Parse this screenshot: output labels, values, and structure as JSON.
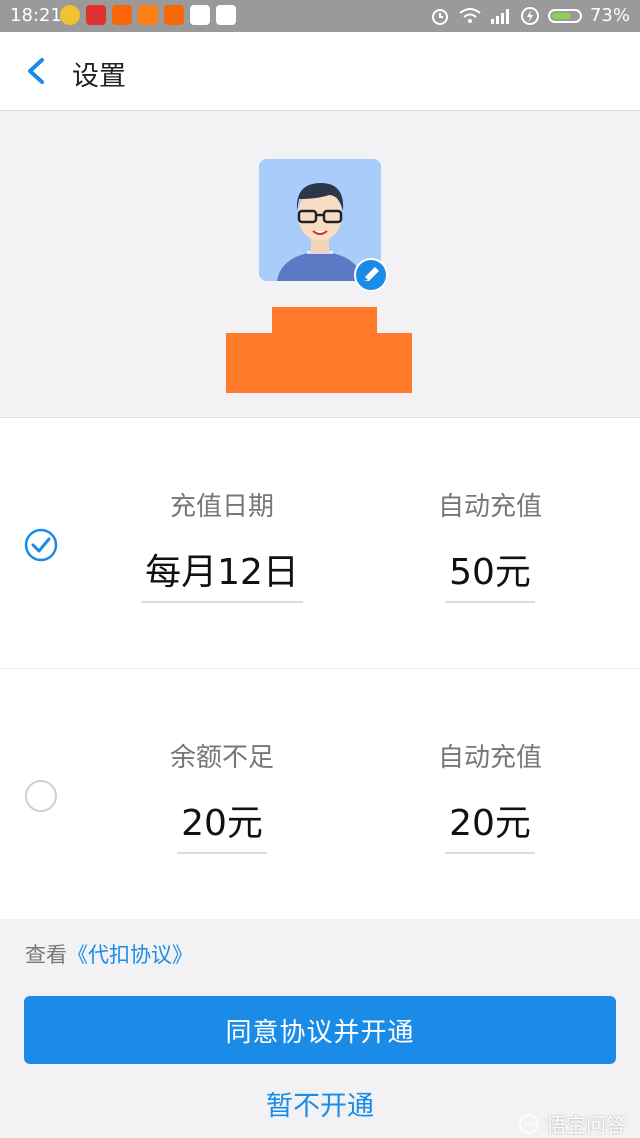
{
  "status_bar": {
    "time": "18:21",
    "battery": "73%",
    "battery_level": 0.73,
    "icons": [
      "app-icon",
      "app-icon",
      "app-icon",
      "app-icon",
      "app-icon",
      "app-icon",
      "app-icon",
      "alarm-icon",
      "wifi-icon",
      "signal-icon",
      "charging-icon",
      "battery-icon"
    ]
  },
  "header": {
    "title": "设置",
    "back_icon": "chevron-left-icon"
  },
  "profile": {
    "avatar": "avatar-illustration",
    "edit_icon": "pencil-icon"
  },
  "options": [
    {
      "selected": true,
      "left_label": "充值日期",
      "left_value": "每月12日",
      "right_label": "自动充值",
      "right_value": "50元"
    },
    {
      "selected": false,
      "left_label": "余额不足",
      "left_value": "20元",
      "right_label": "自动充值",
      "right_value": "20元"
    }
  ],
  "footer": {
    "agreement_prefix": "查看",
    "agreement_link": "《代扣协议》",
    "primary_button": "同意协议并开通",
    "secondary_button": "暂不开通",
    "watermark": "悟空问答"
  },
  "colors": {
    "accent": "#1b8be8",
    "redaction": "#ff7a2b",
    "status_bar": "#9a9a9a"
  }
}
